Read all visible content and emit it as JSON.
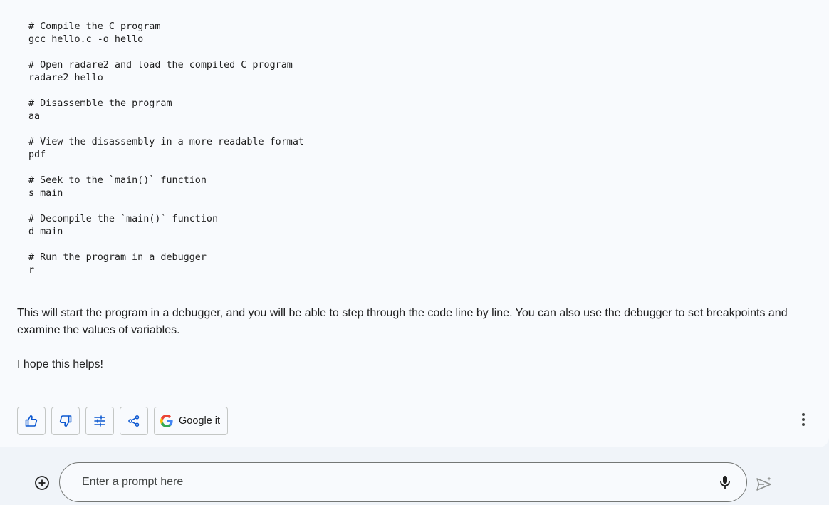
{
  "code": {
    "groups": [
      {
        "comment": "# Compile the C program",
        "command": "gcc hello.c -o hello"
      },
      {
        "comment": "# Open radare2 and load the compiled C program",
        "command": "radare2 hello"
      },
      {
        "comment": "# Disassemble the program",
        "command": "aa"
      },
      {
        "comment": "# View the disassembly in a more readable format",
        "command": "pdf"
      },
      {
        "comment": "# Seek to the `main()` function",
        "command": "s main"
      },
      {
        "comment": "# Decompile the `main()` function",
        "command": "d main"
      },
      {
        "comment": "# Run the program in a debugger",
        "command": "r"
      }
    ]
  },
  "response": {
    "paragraph_1": "This will start the program in a debugger, and you will be able to step through the code line by line. You can also use the debugger to set breakpoints and examine the values of variables.",
    "paragraph_2": "I hope this helps!"
  },
  "actions": {
    "google_label": "Google it",
    "icons": {
      "thumbs_up": "thumbs-up-icon",
      "thumbs_down": "thumbs-down-icon",
      "modify": "tune-icon",
      "share": "share-icon",
      "google": "google-g-icon",
      "more": "more-vertical-icon"
    }
  },
  "prompt": {
    "placeholder": "Enter a prompt here",
    "value": ""
  },
  "colors": {
    "accent": "#0b57d0",
    "card_background": "#f8fafd",
    "page_background": "#f0f4f9",
    "border": "#c4c7c5"
  }
}
